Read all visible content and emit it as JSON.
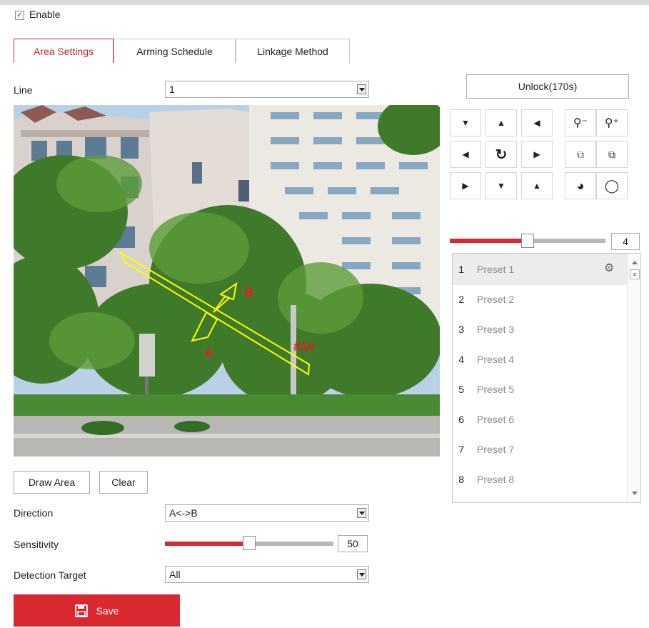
{
  "enable": {
    "label": "Enable",
    "checked": true
  },
  "tabs": [
    {
      "label": "Area Settings",
      "active": true
    },
    {
      "label": "Arming Schedule",
      "active": false
    },
    {
      "label": "Linkage Method",
      "active": false
    }
  ],
  "line": {
    "label": "Line",
    "value": "1"
  },
  "camera": {
    "label_a": "A",
    "label_b": "B",
    "line_id": "#1#"
  },
  "ptz": {
    "unlock_label": "Unlock(170s)",
    "speed_value": "4",
    "speed_fraction": 0.5
  },
  "presets": [
    {
      "num": "1",
      "name": "Preset 1"
    },
    {
      "num": "2",
      "name": "Preset 2"
    },
    {
      "num": "3",
      "name": "Preset 3"
    },
    {
      "num": "4",
      "name": "Preset 4"
    },
    {
      "num": "5",
      "name": "Preset 5"
    },
    {
      "num": "6",
      "name": "Preset 6"
    },
    {
      "num": "7",
      "name": "Preset 7"
    },
    {
      "num": "8",
      "name": "Preset 8"
    }
  ],
  "actions": {
    "draw_area": "Draw Area",
    "clear": "Clear"
  },
  "direction": {
    "label": "Direction",
    "value": "A<->B"
  },
  "sensitivity": {
    "label": "Sensitivity",
    "value": "50",
    "fraction": 0.5
  },
  "detection_target": {
    "label": "Detection Target",
    "value": "All"
  },
  "save": {
    "label": "Save"
  },
  "colors": {
    "accent": "#d9282f",
    "overlay": "#ffff00",
    "text_red": "#e02020"
  }
}
